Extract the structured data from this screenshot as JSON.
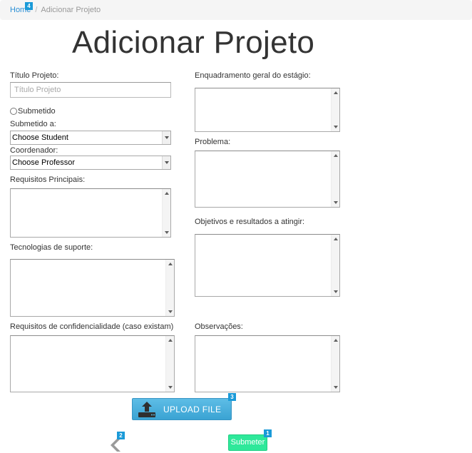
{
  "breadcrumb": {
    "home": "Home",
    "home_badge": "4",
    "current": "Adicionar Projeto"
  },
  "page": {
    "title": "Adicionar Projeto"
  },
  "form": {
    "titulo_label": "Título Projeto:",
    "titulo_placeholder": "Título Projeto",
    "submetido_radio_label": "Submetido",
    "submetido_a_label": "Submetido a:",
    "submetido_a_value": "Choose Student",
    "coordenador_label": "Coordenador:",
    "coordenador_value": "Choose Professor",
    "requisitos_principais_label": "Requisitos Principais:",
    "tecnologias_label": "Tecnologias de suporte:",
    "confidencialidade_label": "Requisitos de confidencialidade (caso existam)",
    "enquadramento_label": "Enquadramento geral do estágio:",
    "problema_label": "Problema:",
    "objetivos_label": "Objetivos e resultados a atingir:",
    "observacoes_label": "Observações:"
  },
  "actions": {
    "upload_label": "UPLOAD FILE",
    "upload_badge": "3",
    "back_badge": "2",
    "submit_label": "Submeter",
    "submit_badge": "1"
  },
  "colors": {
    "link": "#2a8fd6",
    "badge": "#1a9ad8",
    "upload": "#3aa3d3",
    "submit": "#2ee89a"
  }
}
